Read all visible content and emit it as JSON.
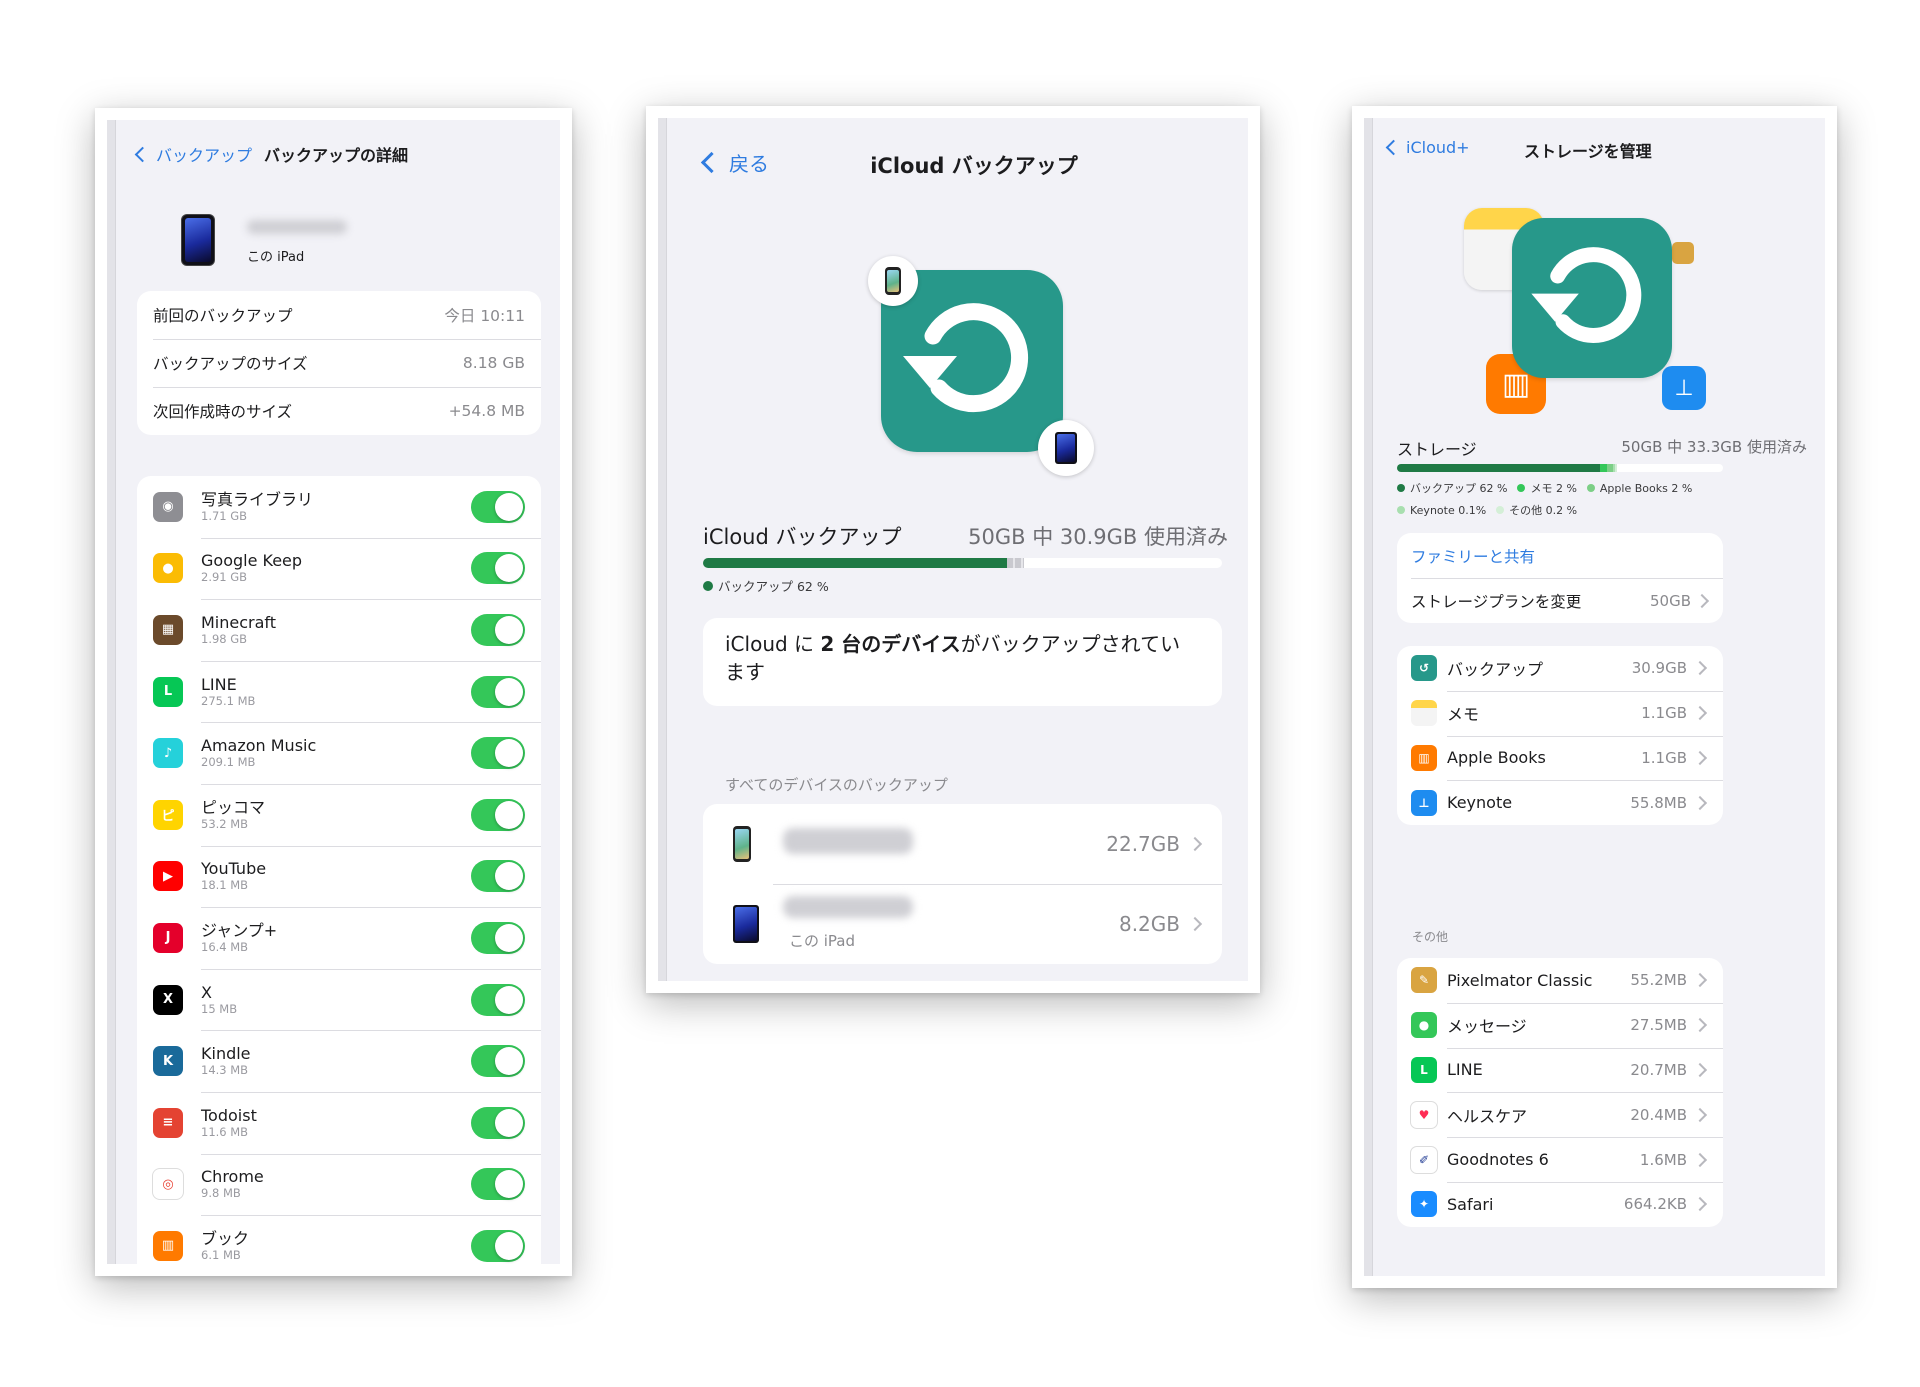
{
  "colors": {
    "link": "#2f7ce0",
    "toggle_on": "#34c759",
    "backup_green": "#27988a",
    "bar_green": "#1f7a45"
  },
  "panel1": {
    "nav": {
      "back_label": "バックアップ",
      "title": "バックアップの詳細"
    },
    "device": {
      "label": "この iPad"
    },
    "info_rows": [
      {
        "label": "前回のバックアップ",
        "value": "今日 10:11"
      },
      {
        "label": "バックアップのサイズ",
        "value": "8.18 GB"
      },
      {
        "label": "次回作成時のサイズ",
        "value": "+54.8 MB"
      }
    ],
    "apps": [
      {
        "name": "写真ライブラリ",
        "size": "1.71 GB",
        "icon": "camera-icon",
        "color": "#8e8e93",
        "glyph": "◉",
        "enabled": true
      },
      {
        "name": "Google Keep",
        "size": "2.91 GB",
        "icon": "google-keep-icon",
        "color": "#fbbc04",
        "glyph": "●",
        "enabled": true
      },
      {
        "name": "Minecraft",
        "size": "1.98 GB",
        "icon": "minecraft-icon",
        "color": "#6b4a2b",
        "glyph": "▦",
        "enabled": true
      },
      {
        "name": "LINE",
        "size": "275.1 MB",
        "icon": "line-icon",
        "color": "#06c755",
        "glyph": "L",
        "enabled": true
      },
      {
        "name": "Amazon Music",
        "size": "209.1 MB",
        "icon": "amazon-music-icon",
        "color": "#25d1da",
        "glyph": "♪",
        "enabled": true
      },
      {
        "name": "ピッコマ",
        "size": "53.2 MB",
        "icon": "piccoma-icon",
        "color": "#ffd400",
        "glyph": "ピ",
        "enabled": true
      },
      {
        "name": "YouTube",
        "size": "18.1 MB",
        "icon": "youtube-icon",
        "color": "#ff0000",
        "glyph": "▶",
        "enabled": true
      },
      {
        "name": "ジャンプ+",
        "size": "16.4 MB",
        "icon": "jump-plus-icon",
        "color": "#e4002b",
        "glyph": "J",
        "enabled": true
      },
      {
        "name": "X",
        "size": "15 MB",
        "icon": "x-icon",
        "color": "#000000",
        "glyph": "X",
        "enabled": true
      },
      {
        "name": "Kindle",
        "size": "14.3 MB",
        "icon": "kindle-icon",
        "color": "#1a6a9a",
        "glyph": "K",
        "enabled": true
      },
      {
        "name": "Todoist",
        "size": "11.6 MB",
        "icon": "todoist-icon",
        "color": "#e44332",
        "glyph": "≡",
        "enabled": true
      },
      {
        "name": "Chrome",
        "size": "9.8 MB",
        "icon": "chrome-icon",
        "color": "#ffffff",
        "glyph": "◎",
        "enabled": true
      },
      {
        "name": "ブック",
        "size": "6.1 MB",
        "icon": "books-icon",
        "color": "#ff7a00",
        "glyph": "▥",
        "enabled": true
      }
    ]
  },
  "panel2": {
    "nav": {
      "back_label": "戻る",
      "title": "iCloud バックアップ"
    },
    "usage": {
      "label": "iCloud バックアップ",
      "value": "50GB 中 30.9GB 使用済み",
      "used_fraction": 0.618,
      "backup_fraction": 0.585
    },
    "legend": [
      {
        "label": "バックアップ 62 %",
        "color": "#1f7a45"
      }
    ],
    "message": {
      "pre": "iCloud に ",
      "bold": "2 台のデバイス",
      "post": "がバックアップされています"
    },
    "section_header": "すべてのデバイスのバックアップ",
    "devices": [
      {
        "sub": "",
        "size": "22.7GB",
        "icon": "iphone-icon"
      },
      {
        "sub": "この iPad",
        "size": "8.2GB",
        "icon": "ipad-icon"
      }
    ]
  },
  "panel3": {
    "nav": {
      "back_label": "iCloud+",
      "title": "ストレージを管理"
    },
    "usage": {
      "label": "ストレージ",
      "value": "50GB 中 33.3GB 使用済み",
      "used_fraction": 0.666
    },
    "legend": [
      {
        "label": "バックアップ 62 %",
        "color": "#1f7a45"
      },
      {
        "label": "メモ 2 %",
        "color": "#34c759"
      },
      {
        "label": "Apple Books 2 %",
        "color": "#7ccf86"
      },
      {
        "label": "Keynote 0.1%",
        "color": "#a8dfaf"
      },
      {
        "label": "その他 0.2 %",
        "color": "#d4efd7"
      }
    ],
    "plan": {
      "family_label": "ファミリーと共有",
      "change_label": "ストレージプランを変更",
      "change_value": "50GB"
    },
    "main_apps": [
      {
        "name": "バックアップ",
        "size": "30.9GB",
        "icon": "backup-icon",
        "color": "#27988a",
        "glyph": "↺"
      },
      {
        "name": "メモ",
        "size": "1.1GB",
        "icon": "notes-icon",
        "color": "#ffd54a",
        "glyph": ""
      },
      {
        "name": "Apple Books",
        "size": "1.1GB",
        "icon": "books-icon",
        "color": "#ff7a00",
        "glyph": "▥"
      },
      {
        "name": "Keynote",
        "size": "55.8MB",
        "icon": "keynote-icon",
        "color": "#1e8cf0",
        "glyph": "⊥"
      }
    ],
    "other_header": "その他",
    "other_apps": [
      {
        "name": "Pixelmator Classic",
        "size": "55.2MB",
        "icon": "pixelmator-icon",
        "color": "#d9a441",
        "glyph": "✎"
      },
      {
        "name": "メッセージ",
        "size": "27.5MB",
        "icon": "messages-icon",
        "color": "#34c759",
        "glyph": "●"
      },
      {
        "name": "LINE",
        "size": "20.7MB",
        "icon": "line-icon",
        "color": "#06c755",
        "glyph": "L"
      },
      {
        "name": "ヘルスケア",
        "size": "20.4MB",
        "icon": "health-icon",
        "color": "#ffffff",
        "glyph": "♥"
      },
      {
        "name": "Goodnotes 6",
        "size": "1.6MB",
        "icon": "goodnotes-icon",
        "color": "#ffffff",
        "glyph": "✐"
      },
      {
        "name": "Safari",
        "size": "664.2KB",
        "icon": "safari-icon",
        "color": "#1a8cff",
        "glyph": "✦"
      }
    ]
  }
}
